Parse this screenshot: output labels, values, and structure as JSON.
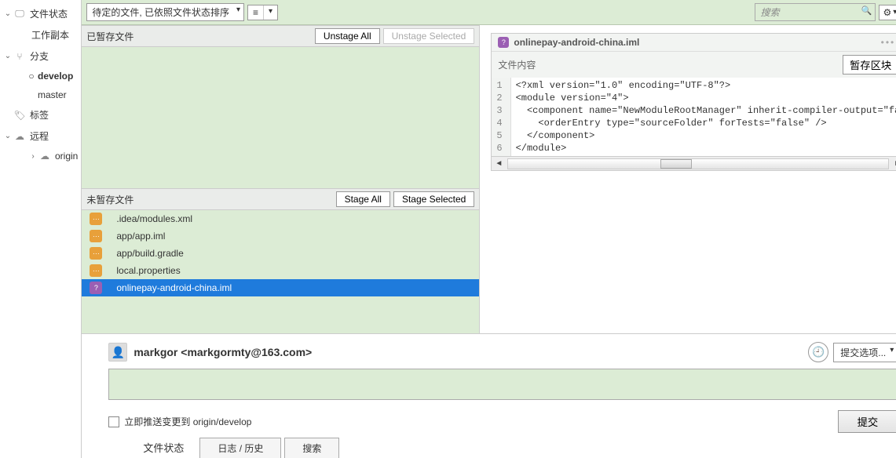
{
  "sidebar": {
    "file_status": "文件状态",
    "working_copy": "工作副本",
    "branches": "分支",
    "branch_develop": "develop",
    "branch_master": "master",
    "tags": "标签",
    "remotes": "远程",
    "remote_origin": "origin"
  },
  "headbar": {
    "sort_label": "待定的文件, 已依照文件状态排序",
    "search_placeholder": "搜索"
  },
  "stage": {
    "staged_title": "已暂存文件",
    "unstage_all": "Unstage All",
    "unstage_selected": "Unstage Selected",
    "unstaged_title": "未暂存文件",
    "stage_all": "Stage All",
    "stage_selected": "Stage Selected",
    "files": [
      {
        "name": ".idea/modules.xml",
        "kind": "mod"
      },
      {
        "name": "app/app.iml",
        "kind": "mod"
      },
      {
        "name": "app/build.gradle",
        "kind": "mod"
      },
      {
        "name": "local.properties",
        "kind": "mod"
      },
      {
        "name": "onlinepay-android-china.iml",
        "kind": "q",
        "selected": true
      }
    ]
  },
  "preview": {
    "filename": "onlinepay-android-china.iml",
    "content_label": "文件内容",
    "stage_hunk": "暂存区块",
    "code_lines": [
      "<?xml version=\"1.0\" encoding=\"UTF-8\"?>",
      "<module version=\"4\">",
      "  <component name=\"NewModuleRootManager\" inherit-compiler-output=\"fa",
      "    <orderEntry type=\"sourceFolder\" forTests=\"false\" />",
      "  </component>",
      "</module>"
    ],
    "gutter": "1\n2\n3\n4\n5\n6"
  },
  "commit": {
    "user": "markgor <markgormty@163.com>",
    "options": "提交选项...",
    "push_label": "立即推送变更到 origin/develop",
    "commit_btn": "提交"
  },
  "tabs": {
    "file_status": "文件状态",
    "log": "日志 / 历史",
    "search": "搜索"
  }
}
